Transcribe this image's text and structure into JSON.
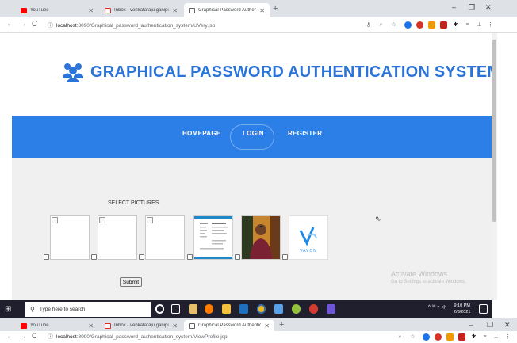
{
  "browser_top": {
    "tabs": [
      {
        "label": "YouTube"
      },
      {
        "label": "Inbox - venkataraju.ganipisetty@..."
      },
      {
        "label": "Graphical Password Authentication"
      }
    ],
    "url": {
      "host": "localhost",
      "path": ":8090/Graphical_password_authentication_system/UVery.jsp"
    },
    "controls": {
      "back": "←",
      "forward": "→",
      "reload": "C",
      "new_tab": "+",
      "minimize": "–",
      "restore": "❐",
      "close": "✕",
      "tab_close": "✕"
    }
  },
  "page": {
    "title": "GRAPHICAL PASSWORD AUTHENTICATION SYSTEM",
    "nav": {
      "home": "HOMEPAGE",
      "login": "LOGIN",
      "register": "REGISTER"
    },
    "select_label": "SELECT PICTURES",
    "pictures": [
      {
        "type": "broken"
      },
      {
        "type": "broken"
      },
      {
        "type": "broken"
      },
      {
        "type": "document"
      },
      {
        "type": "photo"
      },
      {
        "type": "logo",
        "caption": "VAYON"
      }
    ],
    "submit_label": "Submit"
  },
  "watermark": {
    "line1": "Activate Windows",
    "line2": "Go to Settings to activate Windows."
  },
  "taskbar": {
    "search_placeholder": "Type here to search",
    "tray": "^ ⁹⁰ 𝄐 ◁⋅",
    "time": "9:10 PM",
    "date": "2/8/2021"
  },
  "browser_bottom": {
    "tabs": [
      {
        "label": "YouTube"
      },
      {
        "label": "Inbox - venkataraju.ganipisetty@..."
      },
      {
        "label": "Graphical Password Authenticat..."
      }
    ],
    "url": {
      "host": "localhost",
      "path": ":8090/Graphical_password_authentication_system/ViewProfile.jsp"
    }
  },
  "colors": {
    "brand": "#2a73d8",
    "navbar": "#2d7fe8",
    "page_bg": "#f0f0f0",
    "taskbar": "#1f1f2e"
  }
}
